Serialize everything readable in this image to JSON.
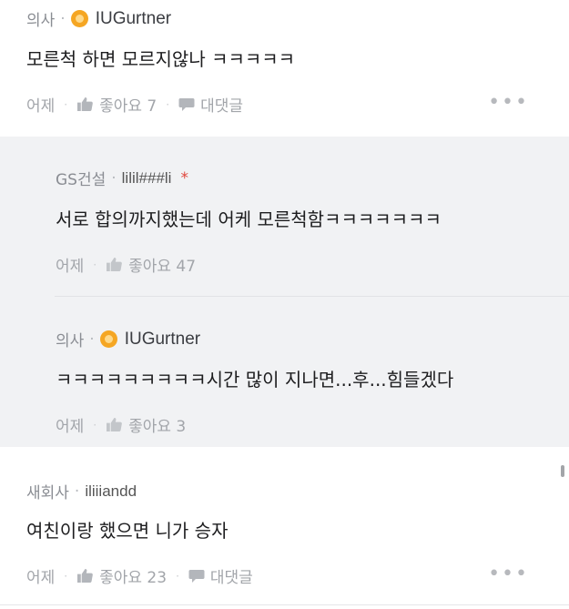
{
  "comments": [
    {
      "company": "의사",
      "nickname": "IUGurtner",
      "text": "모른척 하면 모르지않나 ㅋㅋㅋㅋㅋ",
      "time": "어제",
      "like_label": "좋아요 7",
      "reply_label": "대댓글",
      "more": "•••"
    },
    {
      "company": "새회사",
      "nickname": "iliiiandd",
      "text": "여친이랑 했으면 니가 승자",
      "time": "어제",
      "like_label": "좋아요 23",
      "reply_label": "대댓글",
      "more": "•••"
    }
  ],
  "replies": [
    {
      "company": "GS건설",
      "nickname": "lilil###li",
      "mark": "*",
      "text": "서로 합의까지했는데 어케 모른척함ㅋㅋㅋㅋㅋㅋㅋ",
      "time": "어제",
      "like_label": "좋아요 47"
    },
    {
      "company": "의사",
      "nickname": "IUGurtner",
      "text": "ㅋㅋㅋㅋㅋㅋㅋㅋㅋ시간 많이 지나면...후...힘들겠다",
      "time": "어제",
      "like_label": "좋아요 3"
    }
  ],
  "separator": "·",
  "colors": {
    "badge": "#f5a623",
    "reply_bg": "#f1f2f4",
    "mark": "#e0463c"
  }
}
